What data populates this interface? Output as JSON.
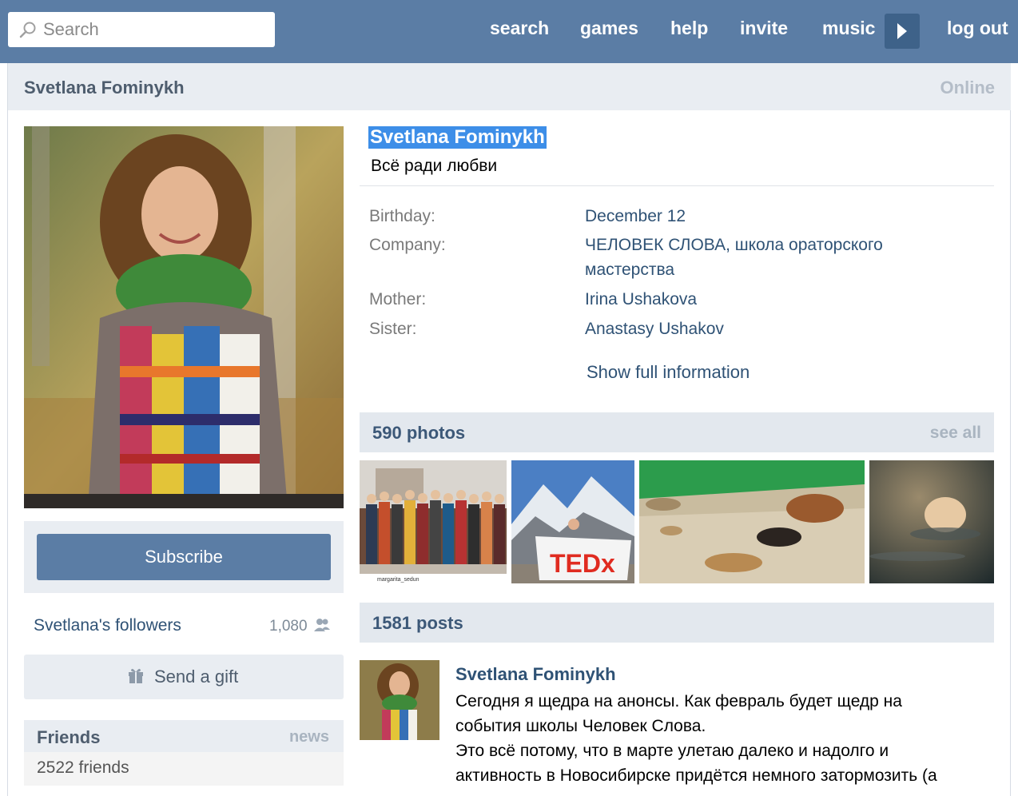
{
  "header": {
    "search_placeholder": "Search",
    "nav": [
      "search",
      "games",
      "help",
      "invite",
      "music"
    ],
    "logout": "log out"
  },
  "profile": {
    "bar_name": "Svetlana Fominykh",
    "online": "Online",
    "name": "Svetlana Fominykh",
    "status": "Всё ради любви",
    "info": [
      {
        "label": "Birthday:",
        "value": "December 12"
      },
      {
        "label": "Company:",
        "value": "ЧЕЛОВЕК СЛОВА, школа ораторского мастерства"
      },
      {
        "label": "Mother:",
        "value": "Irina Ushakova"
      },
      {
        "label": "Sister:",
        "value": "Anastasy Ushakov"
      }
    ],
    "show_full": "Show full information"
  },
  "sidebar": {
    "subscribe": "Subscribe",
    "followers_label": "Svetlana's followers",
    "followers_count": "1,080",
    "send_gift": "Send a gift",
    "friends_title": "Friends",
    "friends_news": "news",
    "friends_count": "2522 friends"
  },
  "photos": {
    "title": "590 photos",
    "see_all": "see all",
    "photo1_caption": "margarita_sedun",
    "photo2_banner": "TEDx"
  },
  "posts": {
    "title": "1581 posts",
    "author": "Svetlana Fominykh",
    "lines": [
      "Сегодня я щедра на анонсы. Как февраль будет щедр на",
      "события школы Человек Слова.",
      "Это всё потому, что в марте улетаю далеко и надолго и",
      "активность в Новосибирске придётся немного затормозить (а"
    ]
  },
  "colors": {
    "header_bg": "#5b7da5",
    "link": "#2f5275",
    "section_bg": "#e9edf2",
    "selection": "#3d8ee8"
  }
}
